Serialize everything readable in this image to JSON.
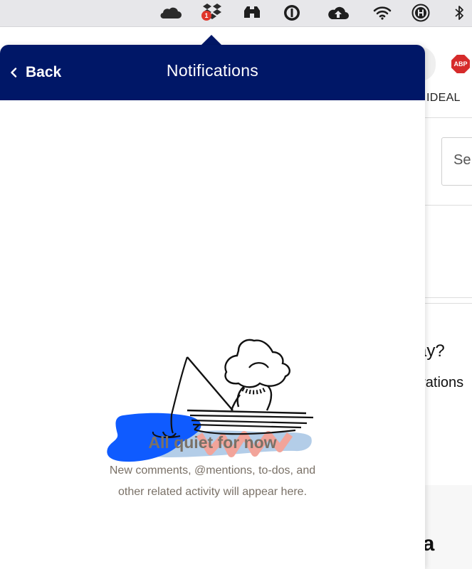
{
  "menubar": {
    "icons": [
      "onedrive-icon",
      "dropbox-icon",
      "binoculars-icon",
      "1password-icon",
      "upload-cloud-icon",
      "wifi-icon",
      "h-circle-icon",
      "bluetooth-icon"
    ],
    "dropbox_badge": "1"
  },
  "background_app": {
    "abp_label": "ABP",
    "nav_text": "IDEAL",
    "box_text": "Se",
    "heading_fragment": "ay?",
    "sub_fragment": "grations",
    "footer_fragment": "ea"
  },
  "panel": {
    "back_label": "Back",
    "title": "Notifications",
    "empty_title": "All quiet for now",
    "empty_line1": "New comments, @mentions, to-dos, and",
    "empty_line2": "other related activity will appear here."
  },
  "colors": {
    "header_bg": "#001767",
    "empty_text": "#7a7167",
    "illustration_blue": "#0f5bff",
    "illustration_light_blue": "#b3cde8",
    "illustration_pink": "#f2a49a"
  }
}
